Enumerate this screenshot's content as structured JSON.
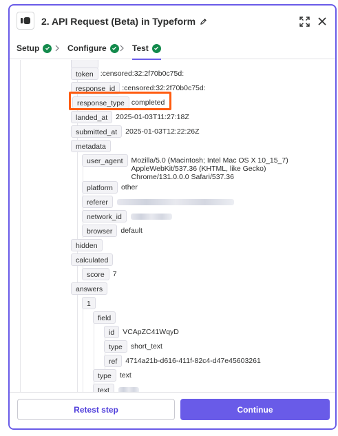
{
  "header": {
    "title": "2. API Request (Beta) in Typeform",
    "icons": [
      "app-icon",
      "pencil-icon",
      "expand-icon",
      "close-icon"
    ]
  },
  "tabs": [
    {
      "label": "Setup",
      "status": "complete"
    },
    {
      "label": "Configure",
      "status": "complete"
    },
    {
      "label": "Test",
      "status": "complete",
      "active": true
    }
  ],
  "data": {
    "token": {
      "key": "token",
      "value": ":censored:32:2f70b0c75d:"
    },
    "response_id": {
      "key": "response_id",
      "value": ":censored:32:2f70b0c75d:"
    },
    "response_type": {
      "key": "response_type",
      "value": "completed"
    },
    "landed_at": {
      "key": "landed_at",
      "value": "2025-01-03T11:27:18Z"
    },
    "submitted_at": {
      "key": "submitted_at",
      "value": "2025-01-03T12:22:26Z"
    },
    "metadata": {
      "key": "metadata",
      "user_agent": {
        "key": "user_agent",
        "value": "Mozilla/5.0 (Macintosh; Intel Mac OS X 10_15_7) AppleWebKit/537.36 (KHTML, like Gecko) Chrome/131.0.0.0 Safari/537.36"
      },
      "platform": {
        "key": "platform",
        "value": "other"
      },
      "referer": {
        "key": "referer"
      },
      "network_id": {
        "key": "network_id"
      },
      "browser": {
        "key": "browser",
        "value": "default"
      }
    },
    "hidden": {
      "key": "hidden"
    },
    "calculated": {
      "key": "calculated",
      "score": {
        "key": "score",
        "value": "7"
      }
    },
    "answers": {
      "key": "answers",
      "index": "1",
      "field": {
        "key": "field",
        "id": {
          "key": "id",
          "value": "VCApZC41WqyD"
        },
        "type": {
          "key": "type",
          "value": "short_text"
        },
        "ref": {
          "key": "ref",
          "value": "4714a21b-d616-411f-82c4-d47e45603261"
        }
      },
      "type": {
        "key": "type",
        "value": "text"
      },
      "text": {
        "key": "text"
      }
    }
  },
  "footer": {
    "retest_label": "Retest step",
    "continue_label": "Continue"
  },
  "colors": {
    "accent": "#695be8",
    "success": "#138a4c",
    "highlight": "#ff5b0f"
  }
}
